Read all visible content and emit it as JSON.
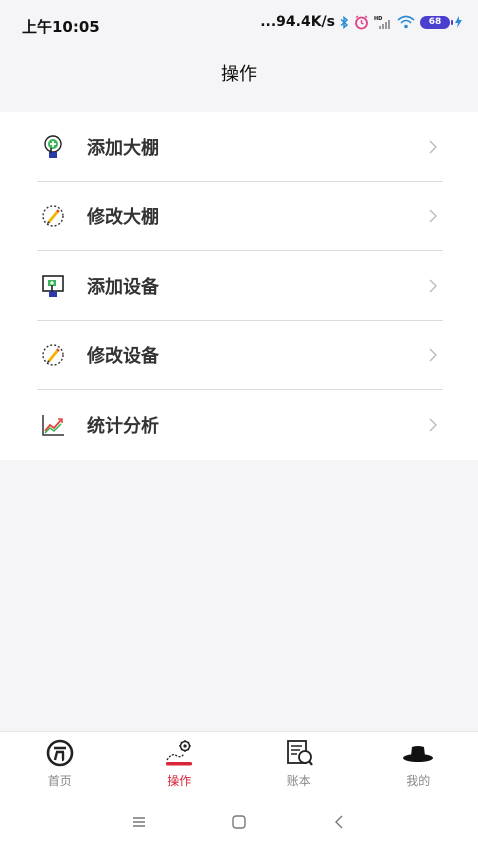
{
  "status": {
    "time": "上午10:05",
    "speed": "...94.4K/s",
    "battery": "68",
    "hd": "HD"
  },
  "header": {
    "title": "操作"
  },
  "menu": [
    {
      "label": "添加大棚",
      "icon": "add-greenhouse-icon"
    },
    {
      "label": "修改大棚",
      "icon": "edit-greenhouse-icon"
    },
    {
      "label": "添加设备",
      "icon": "add-device-icon"
    },
    {
      "label": "修改设备",
      "icon": "edit-device-icon"
    },
    {
      "label": "统计分析",
      "icon": "statistics-chart-icon"
    }
  ],
  "tabs": [
    {
      "label": "首页",
      "icon": "home-icon",
      "active": false
    },
    {
      "label": "操作",
      "icon": "operation-gear-icon",
      "active": true
    },
    {
      "label": "账本",
      "icon": "ledger-icon",
      "active": false
    },
    {
      "label": "我的",
      "icon": "profile-hat-icon",
      "active": false
    }
  ],
  "colors": {
    "accent": "#d8253a",
    "battery": "#4b3fd0",
    "background": "#f5f5f7"
  }
}
